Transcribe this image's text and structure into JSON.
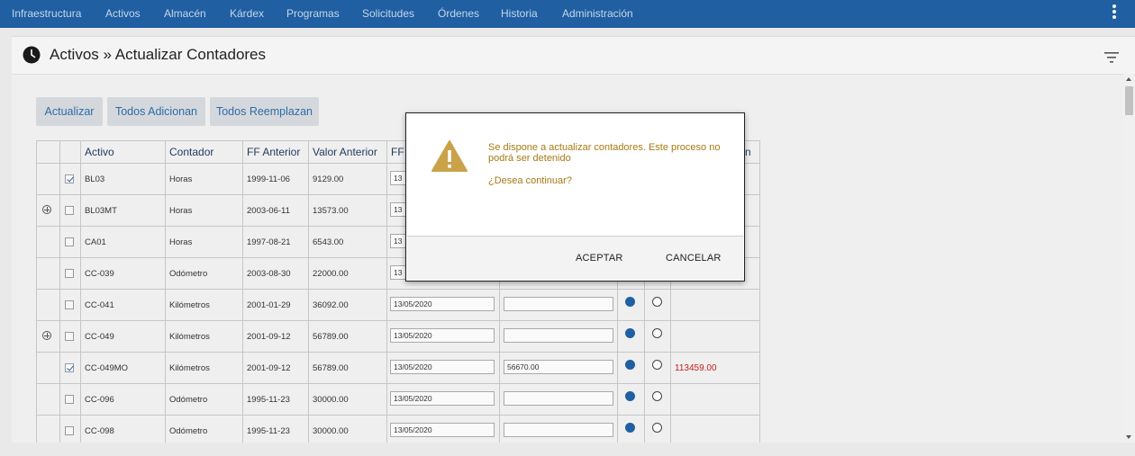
{
  "nav": {
    "items": [
      "Infraestructura",
      "Activos",
      "Almacén",
      "Kárdex",
      "Programas",
      "Solicitudes",
      "Órdenes",
      "Historia",
      "Administración"
    ]
  },
  "header": {
    "title": "Activos » Actualizar Contadores"
  },
  "toolbar": {
    "update_label": "Actualizar",
    "all_add_label": "Todos Adicionan",
    "all_replace_label": "Todos Reemplazan"
  },
  "table": {
    "columns": [
      "Activo",
      "Contador",
      "FF Anterior",
      "Valor Anterior",
      "FF",
      "n"
    ],
    "rows": [
      {
        "expand": false,
        "checked": true,
        "activo": "BL03",
        "contador": "Horas",
        "ff_anterior": "1999-11-06",
        "valor_anterior": "9129.00",
        "ff": "13",
        "valor": "",
        "radio": "",
        "result": ""
      },
      {
        "expand": true,
        "checked": false,
        "activo": "BL03MT",
        "contador": "Horas",
        "ff_anterior": "2003-06-11",
        "valor_anterior": "13573.00",
        "ff": "13",
        "valor": "",
        "radio": "",
        "result": ""
      },
      {
        "expand": false,
        "checked": false,
        "activo": "CA01",
        "contador": "Horas",
        "ff_anterior": "1997-08-21",
        "valor_anterior": "6543.00",
        "ff": "13",
        "valor": "",
        "radio": "",
        "result": ""
      },
      {
        "expand": false,
        "checked": false,
        "activo": "CC-039",
        "contador": "Odómetro",
        "ff_anterior": "2003-08-30",
        "valor_anterior": "22000.00",
        "ff": "13",
        "valor": "",
        "radio": "",
        "result": ""
      },
      {
        "expand": false,
        "checked": false,
        "activo": "CC-041",
        "contador": "Kilómetros",
        "ff_anterior": "2001-01-29",
        "valor_anterior": "36092.00",
        "ff": "13/05/2020",
        "valor": "",
        "radio": "first",
        "result": ""
      },
      {
        "expand": true,
        "checked": false,
        "activo": "CC-049",
        "contador": "Kilómetros",
        "ff_anterior": "2001-09-12",
        "valor_anterior": "56789.00",
        "ff": "13/05/2020",
        "valor": "",
        "radio": "first",
        "result": ""
      },
      {
        "expand": false,
        "checked": true,
        "activo": "CC-049MO",
        "contador": "Kilómetros",
        "ff_anterior": "2001-09-12",
        "valor_anterior": "56789.00",
        "ff": "13/05/2020",
        "valor": "56670.00",
        "radio": "first",
        "result": "113459.00"
      },
      {
        "expand": false,
        "checked": false,
        "activo": "CC-096",
        "contador": "Odómetro",
        "ff_anterior": "1995-11-23",
        "valor_anterior": "30000.00",
        "ff": "13/05/2020",
        "valor": "",
        "radio": "first",
        "result": ""
      },
      {
        "expand": false,
        "checked": false,
        "activo": "CC-098",
        "contador": "Odómetro",
        "ff_anterior": "1995-11-23",
        "valor_anterior": "30000.00",
        "ff": "13/05/2020",
        "valor": "",
        "radio": "first",
        "result": ""
      }
    ]
  },
  "dialog": {
    "message": "Se dispone a actualizar contadores. Este proceso no podrá ser detenido",
    "question": "¿Desea continuar?",
    "accept_label": "ACEPTAR",
    "cancel_label": "CANCELAR"
  },
  "colors": {
    "nav_bg": "#1f5fa2",
    "accent": "#2f6da6",
    "warning": "#c9a24a",
    "warning_text": "#a77a12",
    "negative": "#c02020"
  },
  "icons": {
    "header": "clock-icon",
    "filter": "filter-icon",
    "menu": "kebab-menu-icon",
    "dialog": "warning-icon"
  }
}
